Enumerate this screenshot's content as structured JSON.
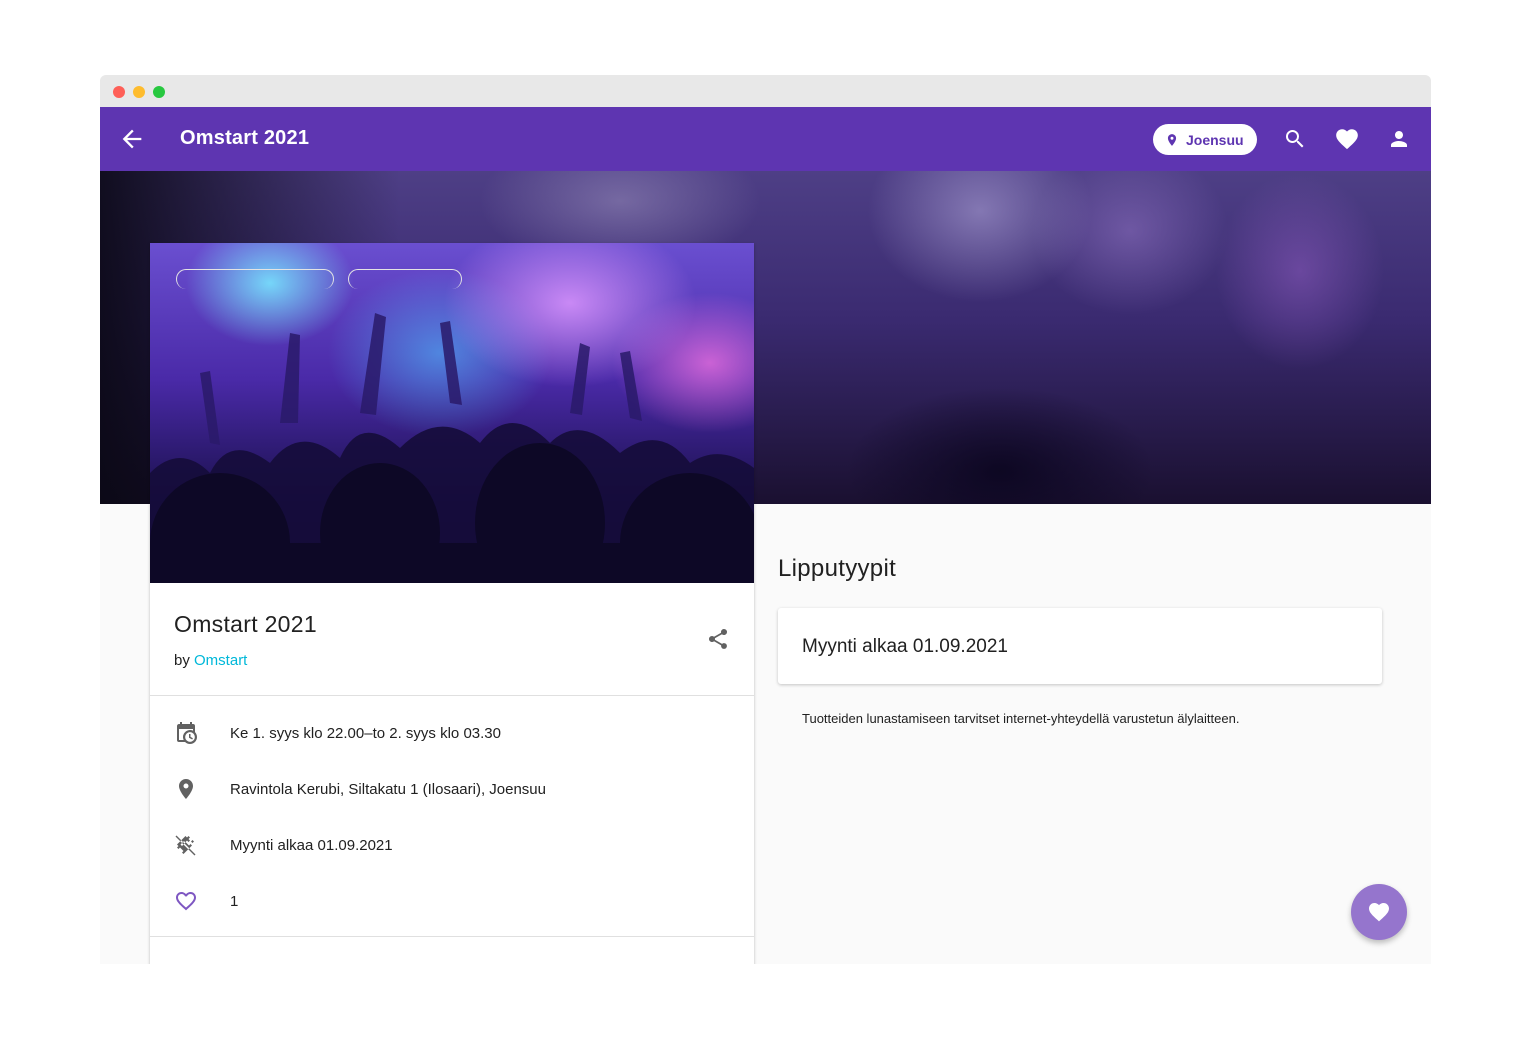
{
  "appbar": {
    "title": "Omstart 2021",
    "location_label": "Joensuu",
    "icons": [
      "arrow-back-icon",
      "location-pin-icon",
      "search-icon",
      "heart-icon",
      "user-icon"
    ]
  },
  "event": {
    "title": "Omstart 2021",
    "by_prefix": "by",
    "organizer": "Omstart",
    "info": [
      {
        "icon": "calendar-clock-icon",
        "text": "Ke 1. syys klo 22.00–to 2. syys klo 03.30"
      },
      {
        "icon": "location-pin-icon",
        "text": "Ravintola Kerubi, Siltakatu 1 (Ilosaari), Joensuu"
      },
      {
        "icon": "ticket-off-icon",
        "text": "Myynti alkaa 01.09.2021"
      },
      {
        "icon": "heart-outline-icon",
        "text": "1"
      }
    ]
  },
  "tickets": {
    "section_title": "Lipputyypit",
    "status": "Myynti alkaa 01.09.2021",
    "note": "Tuotteiden lunastamiseen tarvitset internet-yhteydellä varustetun älylaitteen."
  },
  "colors": {
    "primary": "#5e35b1",
    "fab": "#9575cd",
    "link": "#00b8d9",
    "heart_outline": "#7e57c2"
  }
}
